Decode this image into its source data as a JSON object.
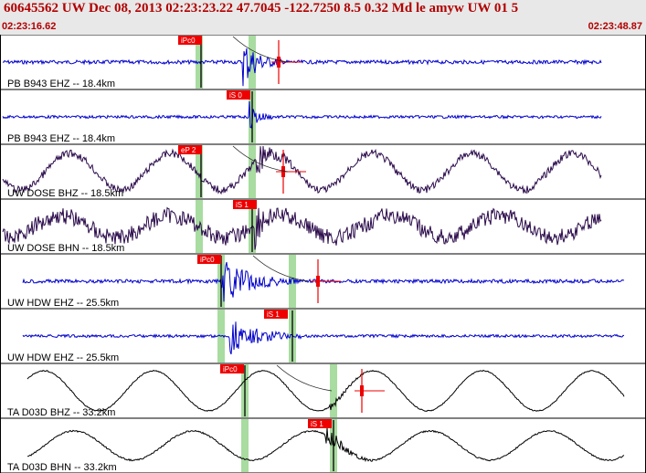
{
  "header": {
    "title": "60645562 UW Dec 08, 2013 02:23:23.22    47.7045 -122.7250  8.5 0.32 Md le amyw UW 01    5",
    "start_time": "02:23:16.62",
    "end_time": "02:23:48.87"
  },
  "colors": {
    "header_text": "#b20000",
    "trace_blue": "#0000cc",
    "trace_dark": "#2a0a4a",
    "trace_black": "#000000",
    "pick_red": "#ee0000",
    "pick_window_green": "#a8dca0"
  },
  "traces": [
    {
      "label": "PB B943 EHZ -- 18.4km",
      "pick_label": "iPc0",
      "pick_color": "red"
    },
    {
      "label": "PB B943 EHZ -- 18.4km",
      "pick_label": "iS 0",
      "pick_color": "red"
    },
    {
      "label": "UW DOSE BHZ -- 18.5km",
      "pick_label": "eP 2",
      "pick_color": "red"
    },
    {
      "label": "UW DOSE BHN -- 18.5km",
      "pick_label": "iS 1",
      "pick_color": "red"
    },
    {
      "label": "UW HDW EHZ -- 25.5km",
      "pick_label": "iPc0",
      "pick_color": "red"
    },
    {
      "label": "UW HDW EHZ -- 25.5km",
      "pick_label": "iS 1",
      "pick_color": "red"
    },
    {
      "label": "TA D03D BHZ -- 33.2km",
      "pick_label": "iPc0",
      "pick_color": "red"
    },
    {
      "label": "TA D03D BHN -- 33.2km",
      "pick_label": "iS 1",
      "pick_color": "red"
    }
  ]
}
